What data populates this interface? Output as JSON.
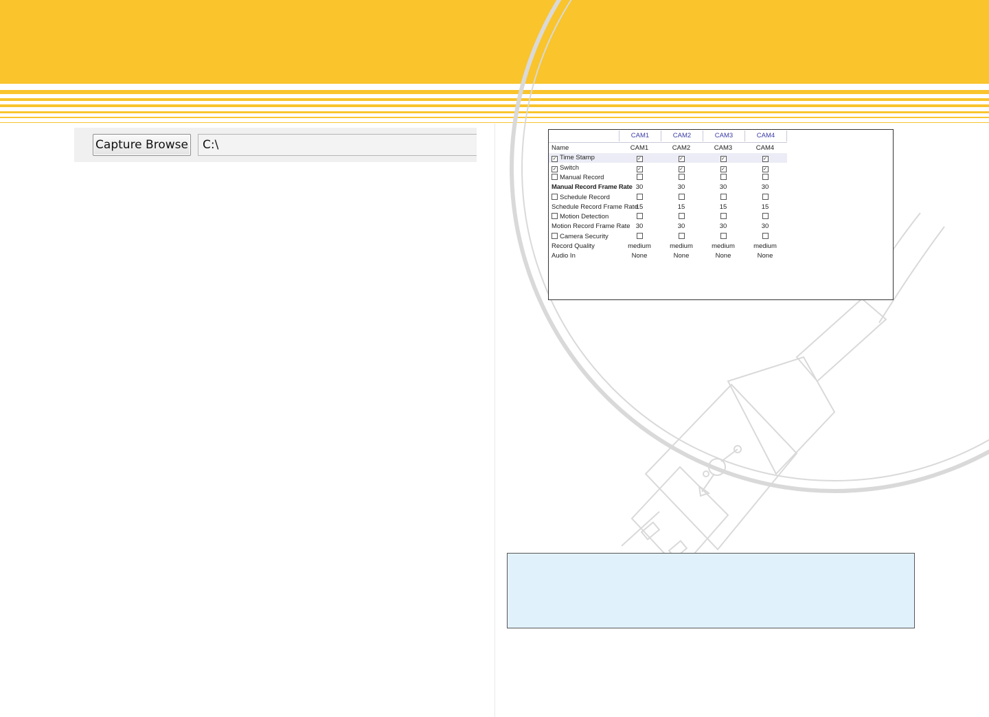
{
  "theme": {
    "accent": "#f9c42c",
    "note_bg": "#e1f1fc"
  },
  "capture": {
    "button_label": "Capture Browse",
    "path_value": "C:\\"
  },
  "settings": {
    "headers": [
      "CAM1",
      "CAM2",
      "CAM3",
      "CAM4"
    ],
    "rows": [
      {
        "label": "Name",
        "kind": "text",
        "values": [
          "CAM1",
          "CAM2",
          "CAM3",
          "CAM4"
        ]
      },
      {
        "label": "Time Stamp",
        "kind": "check",
        "label_checked": true,
        "highlight": true,
        "values": [
          true,
          true,
          true,
          true
        ]
      },
      {
        "label": "Switch",
        "kind": "check",
        "label_checked": true,
        "values": [
          true,
          true,
          true,
          true
        ]
      },
      {
        "label": "Manual Record",
        "kind": "check",
        "label_checked": false,
        "values": [
          false,
          false,
          false,
          false
        ]
      },
      {
        "label": "Manual Record Frame Rate",
        "kind": "text",
        "bold": true,
        "values": [
          "30",
          "30",
          "30",
          "30"
        ]
      },
      {
        "label": "Schedule Record",
        "kind": "check",
        "label_checked": false,
        "values": [
          false,
          false,
          false,
          false
        ]
      },
      {
        "label": "Schedule Record Frame Rate",
        "kind": "text",
        "values": [
          "15",
          "15",
          "15",
          "15"
        ]
      },
      {
        "label": "Motion Detection",
        "kind": "check",
        "label_checked": false,
        "values": [
          false,
          false,
          false,
          false
        ]
      },
      {
        "label": "Motion Record Frame Rate",
        "kind": "text",
        "values": [
          "30",
          "30",
          "30",
          "30"
        ]
      },
      {
        "label": "Camera Security",
        "kind": "check",
        "label_checked": false,
        "values": [
          false,
          false,
          false,
          false
        ]
      },
      {
        "label": "Record Quality",
        "kind": "text",
        "values": [
          "medium",
          "medium",
          "medium",
          "medium"
        ]
      },
      {
        "label": "Audio In",
        "kind": "text",
        "values": [
          "None",
          "None",
          "None",
          "None"
        ]
      }
    ]
  }
}
